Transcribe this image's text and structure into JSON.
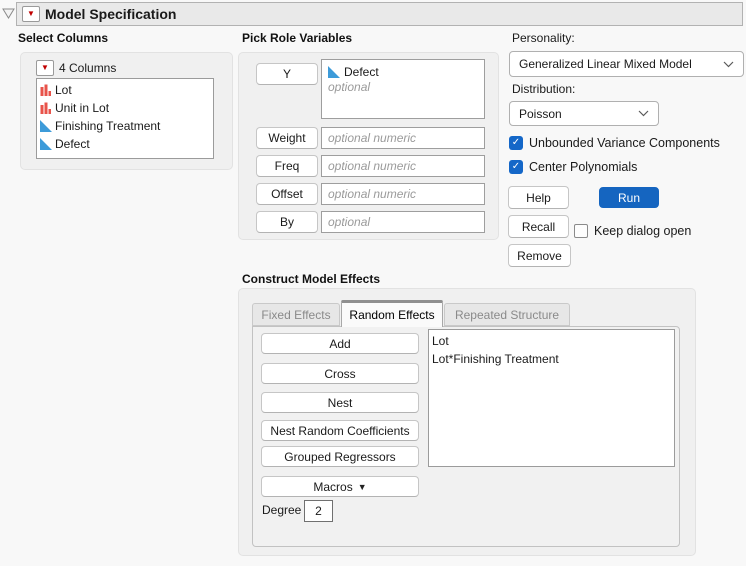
{
  "window": {
    "title": "Model Specification"
  },
  "select_columns": {
    "title": "Select Columns",
    "menu_label": "4 Columns",
    "columns": [
      {
        "name": "Lot",
        "modeling_type": "nominal"
      },
      {
        "name": "Unit in Lot",
        "modeling_type": "nominal"
      },
      {
        "name": "Finishing Treatment",
        "modeling_type": "continuous"
      },
      {
        "name": "Defect",
        "modeling_type": "continuous"
      }
    ]
  },
  "pick_roles": {
    "title": "Pick Role Variables",
    "y": {
      "label": "Y",
      "value": "Defect",
      "value_type": "continuous",
      "placeholder": "optional"
    },
    "weight": {
      "label": "Weight",
      "placeholder": "optional numeric"
    },
    "freq": {
      "label": "Freq",
      "placeholder": "optional numeric"
    },
    "offset": {
      "label": "Offset",
      "placeholder": "optional numeric"
    },
    "by": {
      "label": "By",
      "placeholder": "optional"
    }
  },
  "model_options": {
    "personality_label": "Personality:",
    "personality_value": "Generalized Linear Mixed Model",
    "distribution_label": "Distribution:",
    "distribution_value": "Poisson",
    "unbounded_checkbox": {
      "label": "Unbounded Variance Components",
      "checked": true
    },
    "center_checkbox": {
      "label": "Center Polynomials",
      "checked": true
    }
  },
  "actions": {
    "help": "Help",
    "run": "Run",
    "recall": "Recall",
    "keep_dialog": {
      "label": "Keep dialog open",
      "checked": false
    },
    "remove": "Remove"
  },
  "effects": {
    "title": "Construct Model Effects",
    "tabs": [
      {
        "label": "Fixed Effects",
        "active": false
      },
      {
        "label": "Random Effects",
        "active": true
      },
      {
        "label": "Repeated Structure",
        "active": false
      }
    ],
    "buttons": {
      "add": "Add",
      "cross": "Cross",
      "nest": "Nest",
      "nest_random_coefficients": "Nest Random Coefficients",
      "grouped_regressors": "Grouped Regressors",
      "macros": "Macros"
    },
    "list": [
      "Lot",
      "Lot*Finishing Treatment"
    ],
    "degree_label": "Degree",
    "degree_value": "2"
  },
  "colors": {
    "accent_blue": "#1565c0",
    "checkbox_blue": "#1467c8",
    "nominal_red": "#e8534a",
    "continuous_blue": "#3d9bd9",
    "red_triangle": "#c00000",
    "titlebar_gray": "#e9e9e9"
  }
}
